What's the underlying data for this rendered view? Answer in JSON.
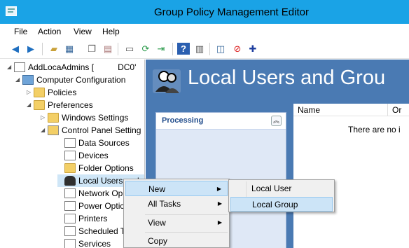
{
  "window": {
    "title": "Group Policy Management Editor"
  },
  "menubar": [
    "File",
    "Action",
    "View",
    "Help"
  ],
  "toolbar": {
    "icons": [
      "back-icon",
      "forward-icon",
      "up-folder-icon",
      "show-hide-tree-icon",
      "copy-icon",
      "paste-icon",
      "print-icon",
      "refresh-icon",
      "export-list-icon",
      "help-icon",
      "show-hide-action-pane-icon",
      "properties-icon",
      "disable-item-icon",
      "add-item-icon"
    ]
  },
  "tree": {
    "nodes": [
      {
        "label": "AddLocaAdmins [",
        "suffix": "DC0'",
        "expander": "◢",
        "icon": "doc"
      },
      {
        "label": "Computer Configuration",
        "expander": "◢",
        "icon": "computer"
      },
      {
        "label": "Policies",
        "expander": "▷",
        "icon": "folder"
      },
      {
        "label": "Preferences",
        "expander": "◢",
        "icon": "folder"
      },
      {
        "label": "Windows Settings",
        "expander": "▷",
        "icon": "folder"
      },
      {
        "label": "Control Panel Setting",
        "expander": "◢",
        "icon": "cpl"
      },
      {
        "label": "Data Sources",
        "expander": "",
        "icon": "doc"
      },
      {
        "label": "Devices",
        "expander": "",
        "icon": "doc"
      },
      {
        "label": "Folder Options",
        "expander": "",
        "icon": "folder"
      },
      {
        "label": "Local Users and",
        "expander": "",
        "icon": "people"
      },
      {
        "label": "Network Op",
        "expander": "",
        "icon": "doc"
      },
      {
        "label": "Power Optic",
        "expander": "",
        "icon": "doc"
      },
      {
        "label": "Printers",
        "expander": "",
        "icon": "doc"
      },
      {
        "label": "Scheduled T",
        "expander": "",
        "icon": "doc"
      },
      {
        "label": "Services",
        "expander": "",
        "icon": "doc"
      }
    ]
  },
  "main": {
    "banner_title": "Local Users and Grou",
    "processing_label": "Processing",
    "columns": [
      "Name",
      "Or"
    ],
    "empty_message": "There are no i"
  },
  "context_menu": {
    "items": [
      {
        "label": "New",
        "submenu": true
      },
      {
        "label": "All Tasks",
        "submenu": true
      },
      {
        "label": "View",
        "submenu": true
      },
      {
        "label": "Copy",
        "submenu": false
      }
    ]
  },
  "submenu": {
    "items": [
      "Local User",
      "Local Group"
    ]
  }
}
